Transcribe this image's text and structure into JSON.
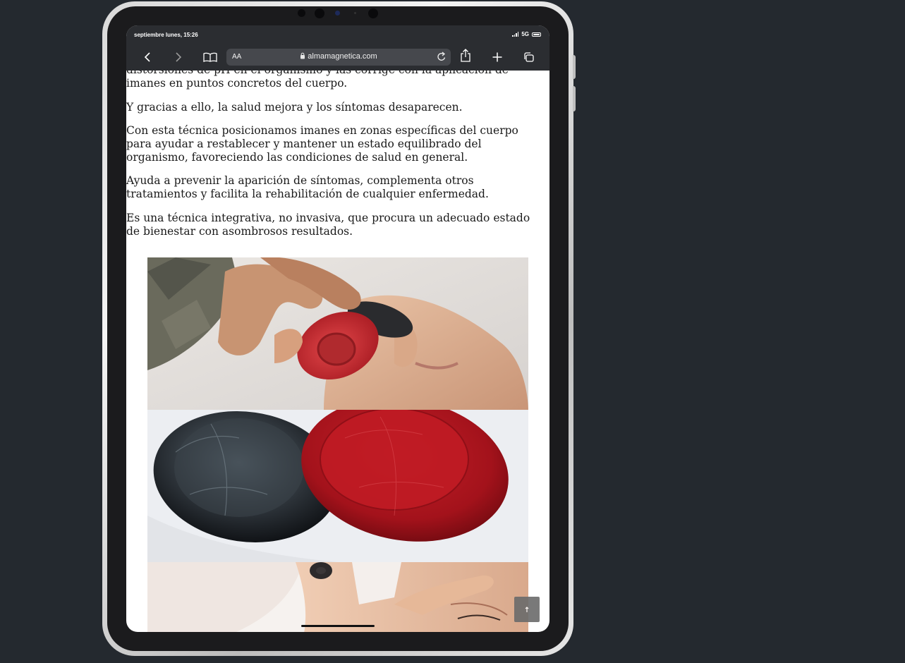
{
  "device": {
    "status_time": "septiembre lunes, 15:26",
    "network": "5G"
  },
  "browser": {
    "text_size_label": "AA",
    "url": "almamagnetica.com",
    "icons": [
      "back-icon",
      "forward-icon",
      "bookmarks-icon",
      "lock-icon",
      "reload-icon",
      "share-icon",
      "new-tab-icon",
      "tabs-icon"
    ]
  },
  "article": {
    "paragraphs": [
      "distorsiones de pH en el organismo y las corrige con la aplicación de imanes en puntos concretos del cuerpo.",
      "Y gracias a ello, la salud mejora y los síntomas desaparecen.",
      "Con esta técnica posicionamos imanes en zonas específicas del cuerpo para ayudar a restablecer y mantener un estado equilibrado del organismo, favoreciendo las condiciones de salud en general.",
      "Ayuda a prevenir la aparición de síntomas, complementa otros tratamientos y facilita la rehabilitación de cualquier enfermedad.",
      "Es una técnica integrativa, no invasiva, que procura un adecuado estado de bienestar con asombrosos resultados."
    ]
  },
  "scroll_top_icon": "arrow-up-icon",
  "colors": {
    "background": "#24292f",
    "browser_bar": "#2b2d31",
    "magnet_red": "#c8242c",
    "magnet_black": "#1e1f22"
  }
}
